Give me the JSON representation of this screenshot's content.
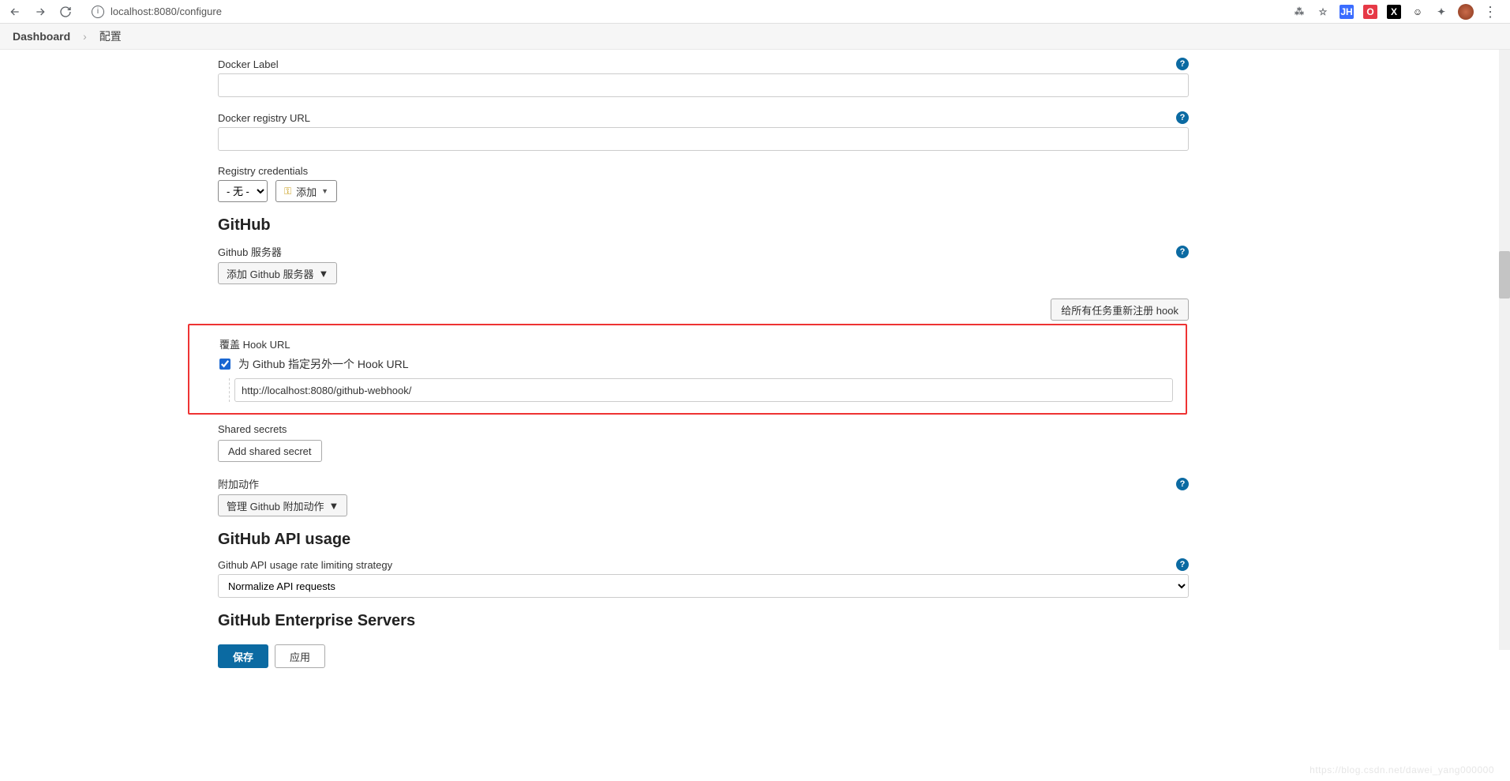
{
  "browser": {
    "url": "localhost:8080/configure"
  },
  "breadcrumb": {
    "dashboard": "Dashboard",
    "current": "配置"
  },
  "docker": {
    "label_label": "Docker Label",
    "label_value": "",
    "registry_url_label": "Docker registry URL",
    "registry_url_value": "",
    "credentials_label": "Registry credentials",
    "credentials_selected": "- 无 -",
    "add_button": "添加"
  },
  "github": {
    "heading": "GitHub",
    "servers_label": "Github 服务器",
    "add_server_btn": "添加 Github 服务器",
    "reregister_btn": "给所有任务重新注册 hook",
    "override_hook_label": "覆盖 Hook URL",
    "override_hook_checkbox_label": "为 Github 指定另外一个 Hook URL",
    "override_hook_checked": true,
    "hook_url_value": "http://localhost:8080/github-webhook/",
    "shared_secrets_label": "Shared secrets",
    "add_secret_btn": "Add shared secret",
    "extra_actions_label": "附加动作",
    "manage_actions_btn": "管理 Github 附加动作"
  },
  "api_usage": {
    "heading": "GitHub API usage",
    "strategy_label": "Github API usage rate limiting strategy",
    "strategy_value": "Normalize API requests"
  },
  "enterprise": {
    "heading": "GitHub Enterprise Servers"
  },
  "footer": {
    "save": "保存",
    "apply": "应用"
  },
  "watermark": "https://blog.csdn.net/dawei_yang000000"
}
